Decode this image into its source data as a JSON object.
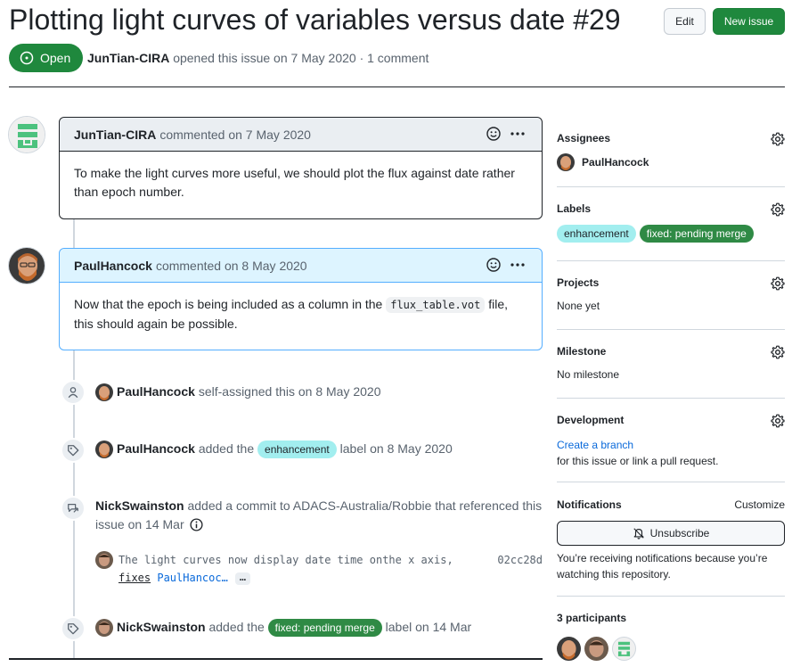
{
  "issue": {
    "title": "Plotting light curves of variables versus date #29",
    "state": "Open",
    "author": "JunTian-CIRA",
    "meta_rest": "opened this issue on 7 May 2020 · 1 comment"
  },
  "header_buttons": {
    "edit": "Edit",
    "new_issue": "New issue"
  },
  "comments": [
    {
      "author": "JunTian-CIRA",
      "when": "commented on 7 May 2020",
      "body": "To make the light curves more useful, we should plot the flux against date rather than epoch number."
    },
    {
      "author": "PaulHancock",
      "when": "commented on 8 May 2020",
      "body_before": "Now that the epoch is being included as a column in the",
      "code": "flux_table.vot",
      "body_after": "file, this should again be possible."
    }
  ],
  "events": {
    "assign": {
      "actor": "PaulHancock",
      "text": "self-assigned this on 8 May 2020"
    },
    "label1": {
      "actor": "PaulHancock",
      "pre": "added the",
      "label": "enhancement",
      "post": "label on 8 May 2020"
    },
    "commit_ref": {
      "actor": "NickSwainston",
      "text": "added a commit to ADACS-Australia/Robbie that referenced this issue on 14 Mar",
      "commit_msg": "The light curves now display date time onthe x axis,",
      "commit_fixes": "fixes",
      "commit_link": "PaulHancoc…",
      "commit_more": "…",
      "sha": "02cc28d"
    },
    "label2": {
      "actor": "NickSwainston",
      "pre": "added the",
      "label": "fixed: pending merge",
      "post": "label on 14 Mar"
    }
  },
  "sidebar": {
    "assignees": {
      "heading": "Assignees",
      "value": "PaulHancock"
    },
    "labels": {
      "heading": "Labels",
      "items": [
        "enhancement",
        "fixed: pending merge"
      ]
    },
    "projects": {
      "heading": "Projects",
      "value": "None yet"
    },
    "milestone": {
      "heading": "Milestone",
      "value": "No milestone"
    },
    "development": {
      "heading": "Development",
      "link": "Create a branch",
      "text": "for this issue or link a pull request."
    },
    "notifications": {
      "heading": "Notifications",
      "customize": "Customize",
      "button": "Unsubscribe",
      "text": "You’re receiving notifications because you’re watching this repository."
    },
    "participants": {
      "heading": "3 participants"
    }
  },
  "colors": {
    "open_green": "#1f883d",
    "label_enhancement": "#a2eeef",
    "label_pending": "#2f8a45",
    "link_blue": "#0969da"
  }
}
